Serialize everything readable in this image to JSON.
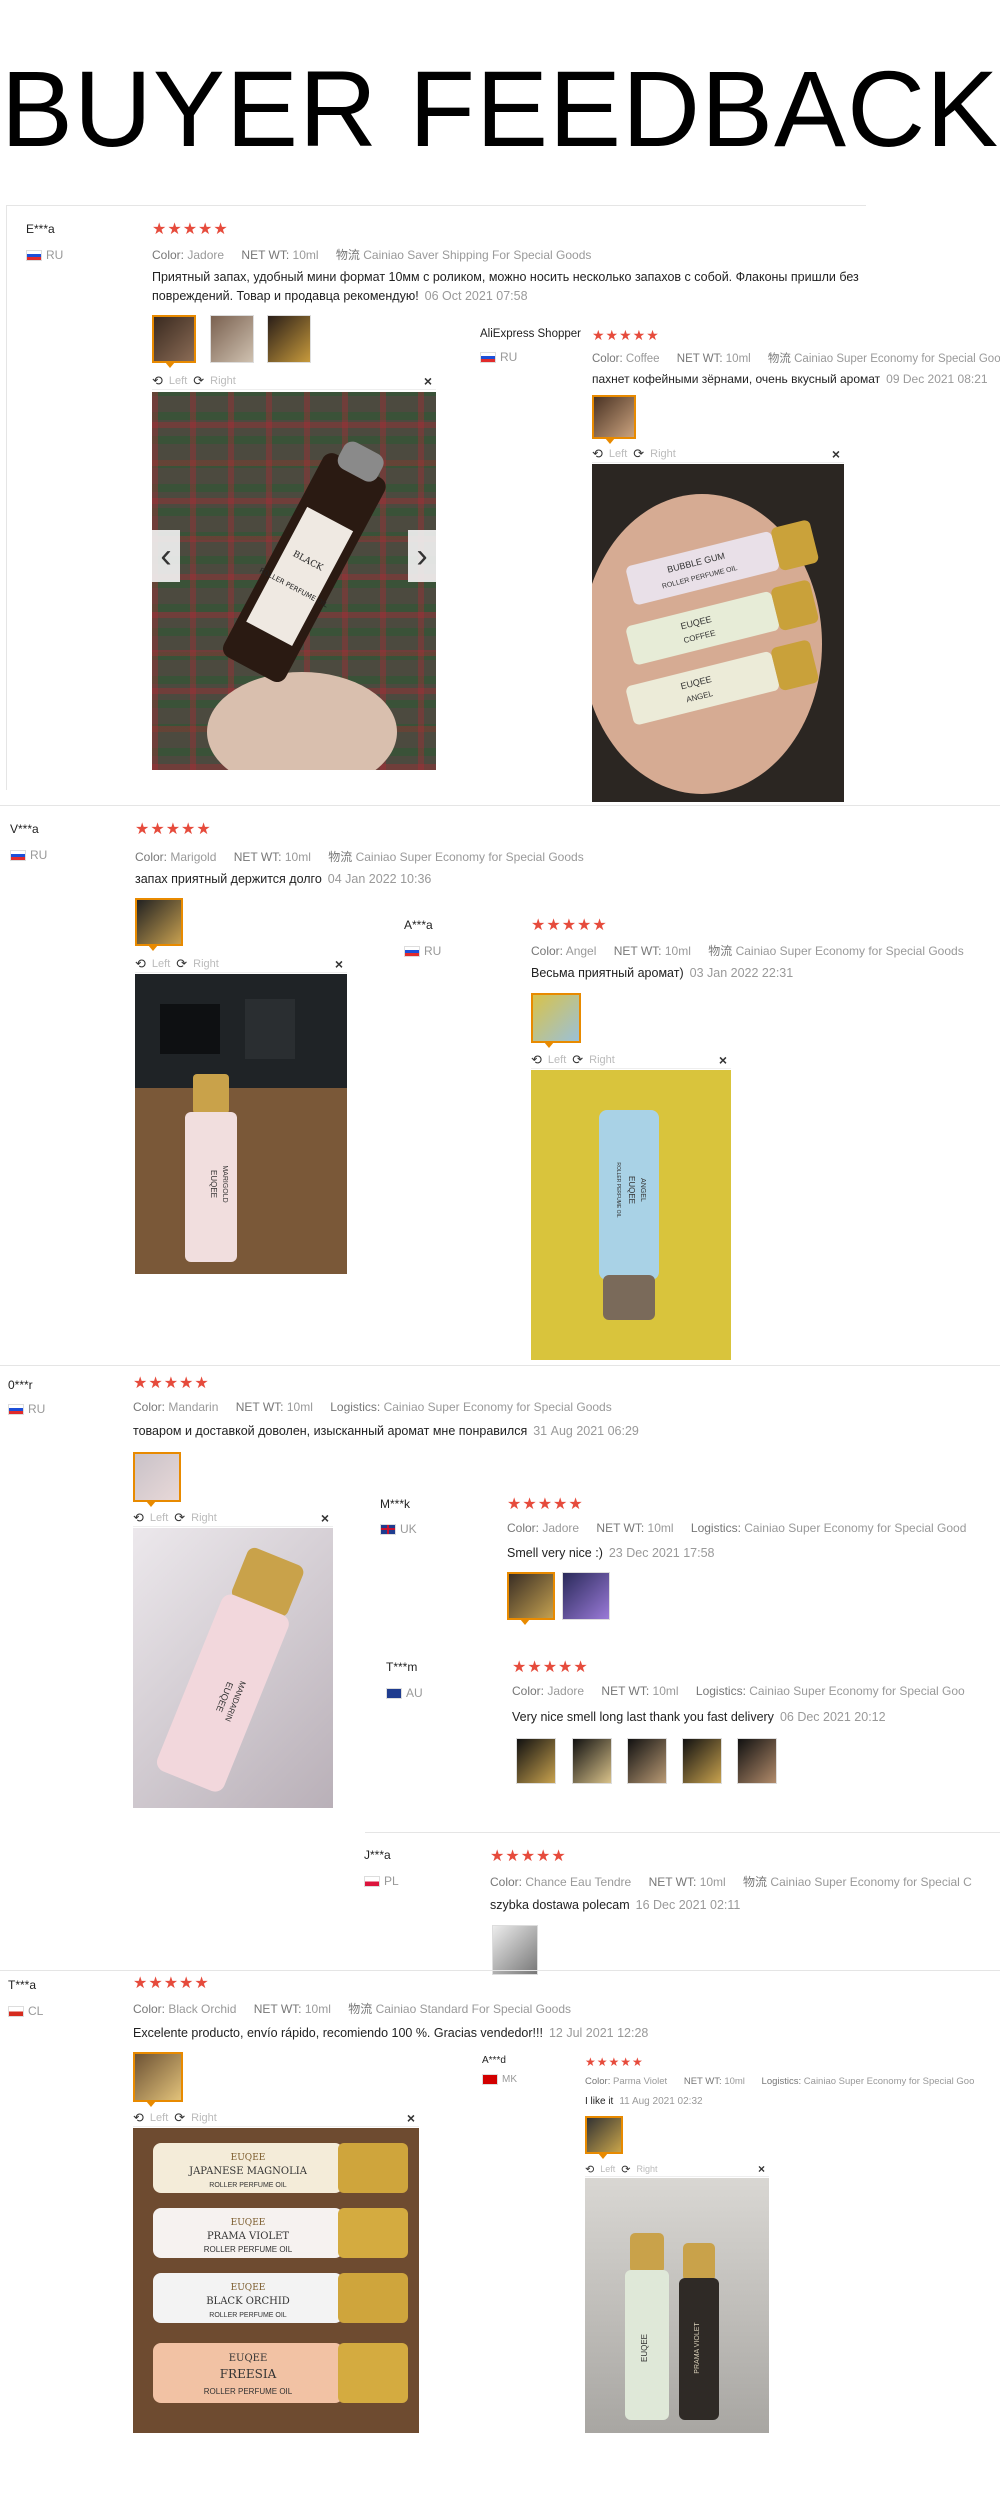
{
  "header": {
    "title": "BUYER FEEDBACK"
  },
  "labels": {
    "color": "Color:",
    "net_wt": "NET WT:",
    "wuliu": "物流",
    "logistics": "Logistics:",
    "left": "Left",
    "right": "Right",
    "close": "×",
    "prev": "‹",
    "next": "›"
  },
  "stars": "★★★★★",
  "reviews": [
    {
      "name": "E***a",
      "country": "RU",
      "color": "Jadore",
      "net_wt": "10ml",
      "shipping": "Cainiao Saver Shipping For Special Goods",
      "text": "Приятный запах, удобный мини формат 10мм с роликом, можно носить несколько запахов с собой. Флаконы пришли без повреждений. Товар и продавца рекомендую!",
      "date": "06 Oct 2021 07:58"
    },
    {
      "name": "AliExpress Shopper",
      "country": "RU",
      "color": "Coffee",
      "net_wt": "10ml",
      "shipping": "Cainiao Super Economy for Special Goo",
      "text": "пахнет кофейными зёрнами, очень вкусный аромат",
      "date": "09 Dec 2021 08:21"
    },
    {
      "name": "V***a",
      "country": "RU",
      "color": "Marigold",
      "net_wt": "10ml",
      "shipping": "Cainiao Super Economy for Special Goods",
      "text": "запах приятный держится долго",
      "date": "04 Jan 2022 10:36"
    },
    {
      "name": "A***a",
      "country": "RU",
      "color": "Angel",
      "net_wt": "10ml",
      "shipping": "Cainiao Super Economy for Special Goods",
      "text": "Весьма приятный аромат)",
      "date": "03 Jan 2022 22:31"
    },
    {
      "name": "0***r",
      "country": "RU",
      "color": "Mandarin",
      "net_wt": "10ml",
      "shipping": "Cainiao Super Economy for Special Goods",
      "text": "товаром и доставкой доволен, изысканный аромат мне понравился",
      "date": "31 Aug 2021 06:29"
    },
    {
      "name": "M***k",
      "country": "UK",
      "color": "Jadore",
      "net_wt": "10ml",
      "shipping": "Cainiao Super Economy for Special Good",
      "text": "Smell very nice :)",
      "date": "23 Dec 2021 17:58"
    },
    {
      "name": "T***m",
      "country": "AU",
      "color": "Jadore",
      "net_wt": "10ml",
      "shipping": "Cainiao Super Economy for Special Goo",
      "text": "Very nice smell long last thank you fast delivery",
      "date": "06 Dec 2021 20:12"
    },
    {
      "name": "J***a",
      "country": "PL",
      "color": "Chance Eau Tendre",
      "net_wt": "10ml",
      "shipping": "Cainiao Super Economy for Special C",
      "text": "szybka dostawa polecam",
      "date": "16 Dec 2021 02:11"
    },
    {
      "name": "T***a",
      "country": "CL",
      "color": "Black Orchid",
      "net_wt": "10ml",
      "shipping": "Cainiao Standard For Special Goods",
      "text": "Excelente producto, envío rápido, recomiendo 100 %. Gracias vendedor!!!",
      "date": "12 Jul 2021 12:28"
    },
    {
      "name": "A***d",
      "country": "MK",
      "color": "Parma Violet",
      "net_wt": "10ml",
      "shipping": "Cainiao Super Economy for Special Goo",
      "text": "I like it",
      "date": "11 Aug 2021 02:32"
    }
  ],
  "bottles": {
    "b1": [
      "ROLLER PERFUME OIL",
      "BLACK"
    ],
    "coffee": [
      "EUQEE",
      "BUBBLE GUM",
      "ROLLER PERFUME OIL",
      "EUQEE",
      "COFFEE",
      "EUQEE",
      "ANGEL"
    ],
    "marigold": [
      "EUQEE",
      "MARIGOLD"
    ],
    "angel": [
      "EUQEE",
      "ANGEL",
      "ROLLER PERFUME OIL"
    ],
    "mandarin": [
      "EUQEE",
      "MANDARIN"
    ],
    "orchid": [
      "EUQEE",
      "JAPANESE MAGNOLIA",
      "ROLLER PERFUME OIL",
      "EUQEE",
      "PRAMA VIOLET",
      "ROLLER PERFUME OIL",
      "EUQEE",
      "BLACK ORCHID",
      "ROLLER PERFUME OIL",
      "EUQEE",
      "FREESIA",
      "ROLLER PERFUME OIL"
    ],
    "violet": [
      "EUQEE",
      "PRAMA VIOLET"
    ]
  },
  "theme": {
    "star_color": "#e64b3c",
    "selected_border": "#e88a00"
  }
}
